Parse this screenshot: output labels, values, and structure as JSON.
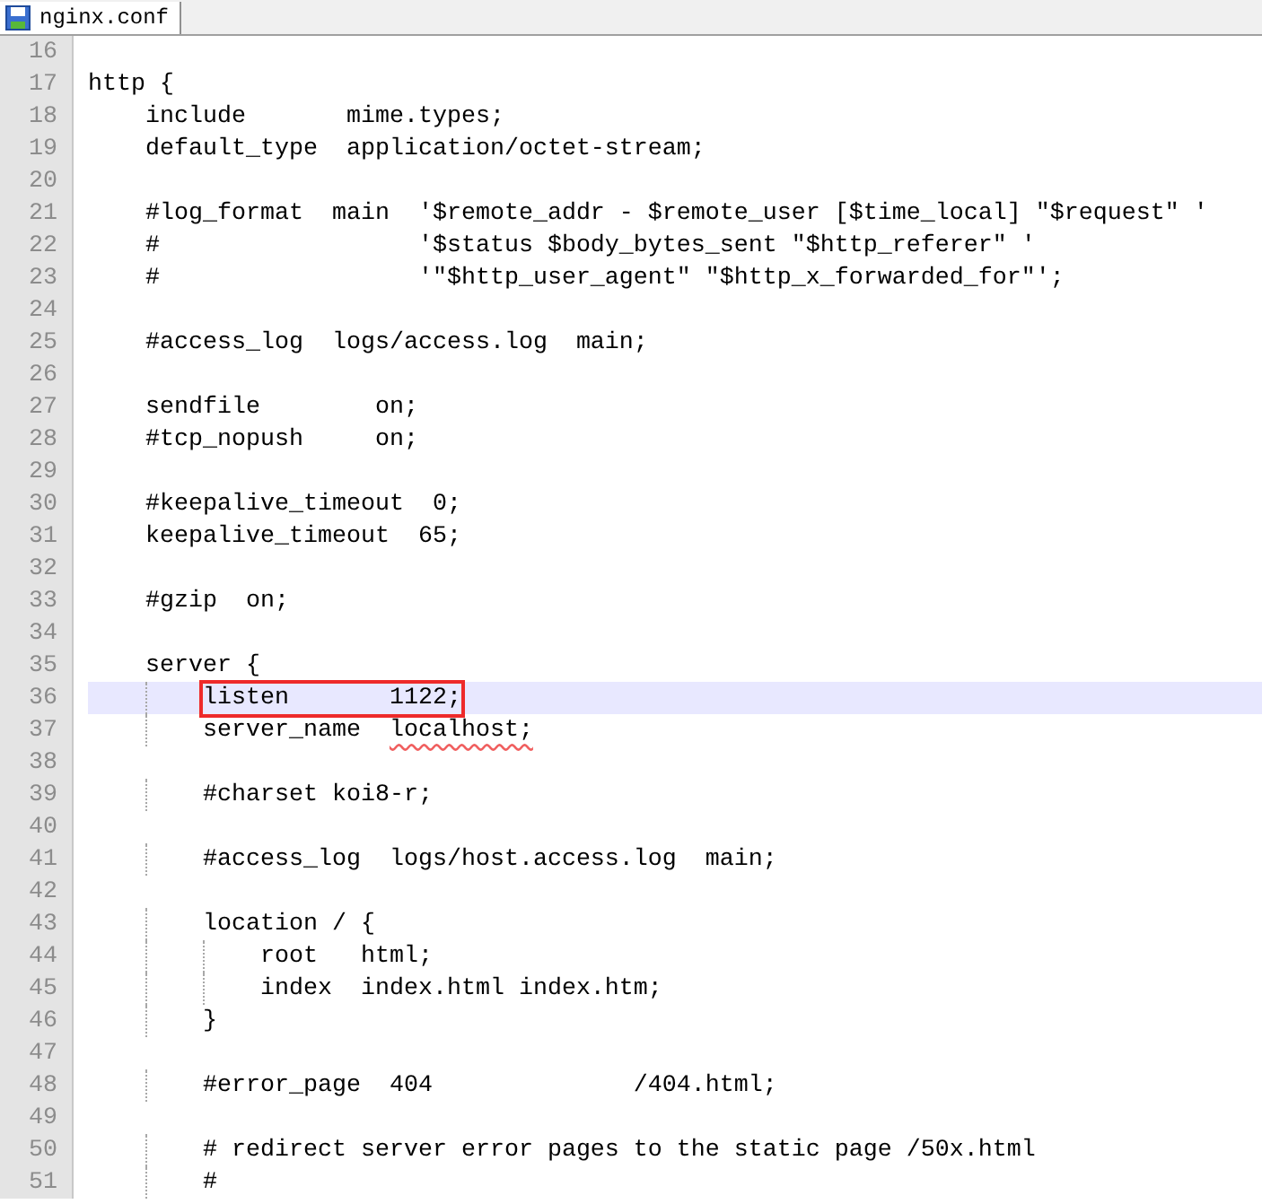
{
  "tabs": [
    {
      "title": "nginx.conf",
      "selected": true
    }
  ],
  "lines": [
    {
      "number": "16",
      "current": false
    },
    {
      "number": "17",
      "text": "http {",
      "current": false
    },
    {
      "number": "18",
      "text": "    include       mime.types;",
      "current": false
    },
    {
      "number": "19",
      "text": "    default_type  application/octet-stream;",
      "current": false
    },
    {
      "number": "20",
      "current": false
    },
    {
      "number": "21",
      "text": "    #log_format  main  '$remote_addr - $remote_user [$time_local] \"$request\" '",
      "current": false
    },
    {
      "number": "22",
      "text": "    #                  '$status $body_bytes_sent \"$http_referer\" '",
      "current": false
    },
    {
      "number": "23",
      "text": "    #                  '\"$http_user_agent\" \"$http_x_forwarded_for\"';",
      "current": false
    },
    {
      "number": "24",
      "current": false
    },
    {
      "number": "25",
      "text": "    #access_log  logs/access.log  main;",
      "current": false
    },
    {
      "number": "26",
      "current": false
    },
    {
      "number": "27",
      "text": "    sendfile        on;",
      "current": false
    },
    {
      "number": "28",
      "text": "    #tcp_nopush     on;",
      "current": false
    },
    {
      "number": "29",
      "current": false
    },
    {
      "number": "30",
      "text": "    #keepalive_timeout  0;",
      "current": false
    },
    {
      "number": "31",
      "text": "    keepalive_timeout  65;",
      "current": false
    },
    {
      "number": "32",
      "current": false
    },
    {
      "number": "33",
      "text": "    #gzip  on;",
      "current": false
    },
    {
      "number": "34",
      "current": false
    },
    {
      "number": "35",
      "text": "    server {",
      "current": false
    },
    {
      "number": "36",
      "segments": [
        {
          "kind": "boxed",
          "text": "listen       1122;"
        }
      ],
      "current": true
    },
    {
      "number": "37",
      "segments": [
        {
          "kind": "plain",
          "text": "        server_name  "
        },
        {
          "kind": "squiggle",
          "text": "localhost;"
        }
      ],
      "current": false
    },
    {
      "number": "38",
      "current": false
    },
    {
      "number": "39",
      "text": "        #charset koi8-r;",
      "current": false
    },
    {
      "number": "40",
      "current": false
    },
    {
      "number": "41",
      "text": "        #access_log  logs/host.access.log  main;",
      "current": false
    },
    {
      "number": "42",
      "current": false
    },
    {
      "number": "43",
      "text": "        location / {",
      "current": false
    },
    {
      "number": "44",
      "text": "            root   html;",
      "current": false
    },
    {
      "number": "45",
      "text": "            index  index.html index.htm;",
      "current": false
    },
    {
      "number": "46",
      "text": "        }",
      "current": false
    },
    {
      "number": "47",
      "current": false
    },
    {
      "number": "48",
      "text": "        #error_page  404              /404.html;",
      "current": false
    },
    {
      "number": "49",
      "current": false
    },
    {
      "number": "50",
      "text": "        # redirect server error pages to the static page /50x.html",
      "current": false
    },
    {
      "number": "51",
      "text": "        #",
      "current": false
    }
  ]
}
